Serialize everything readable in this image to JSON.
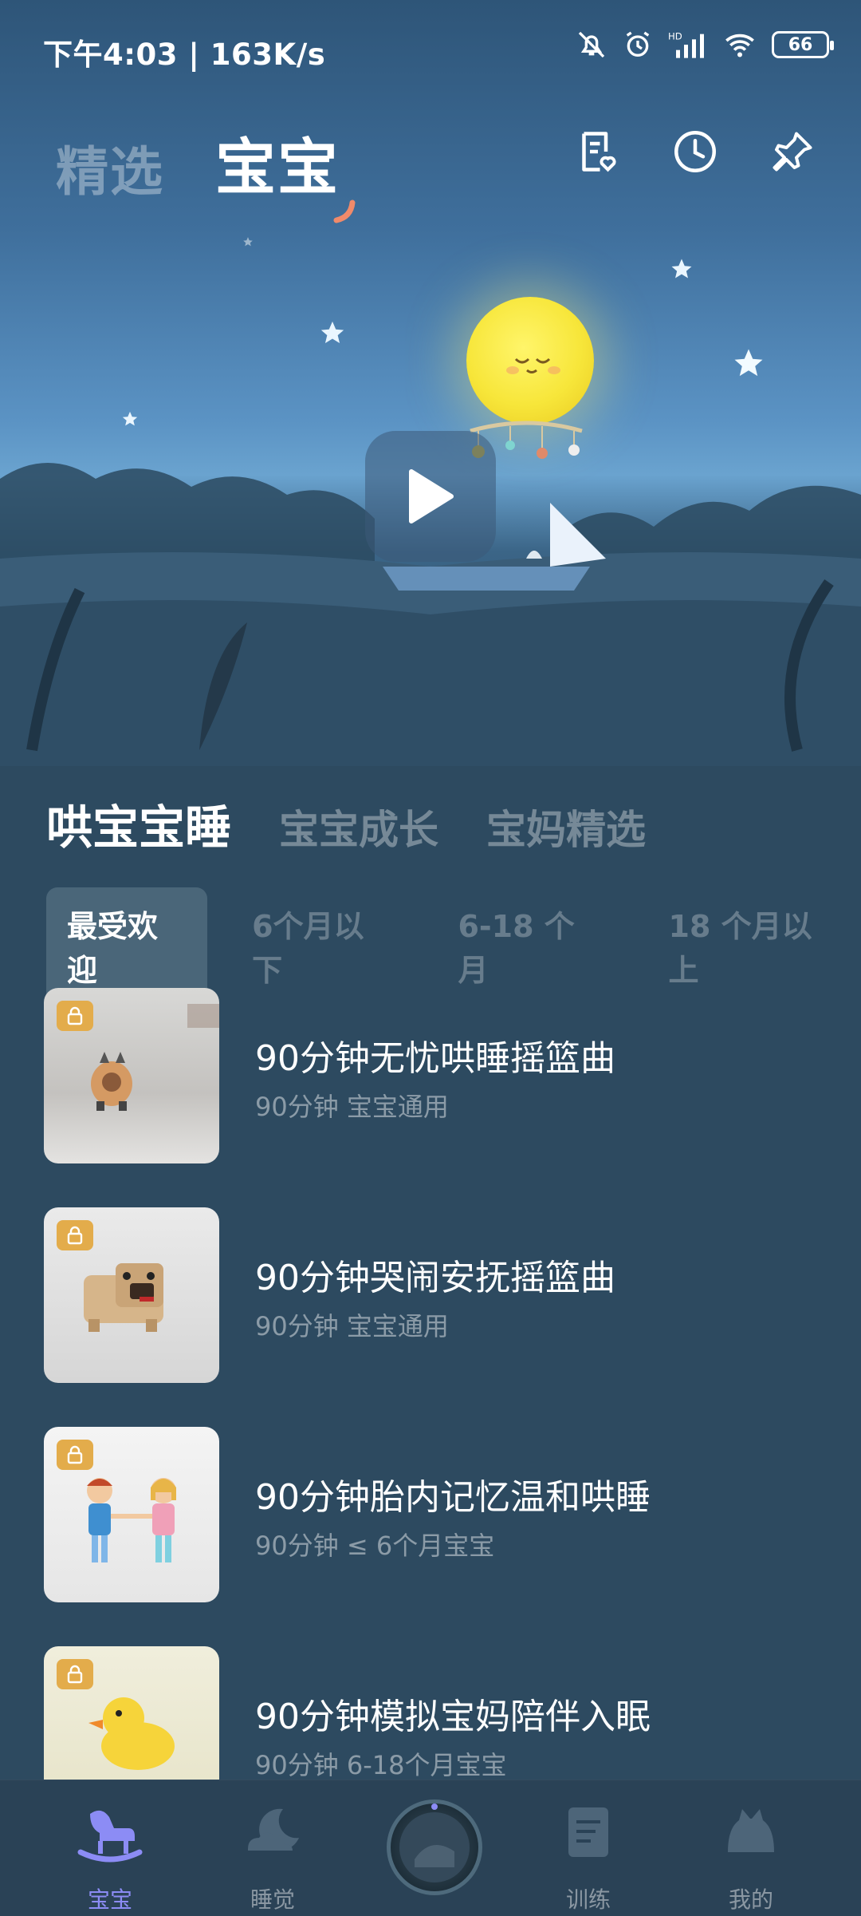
{
  "status_bar": {
    "time": "下午4:03 | 163K/s",
    "battery": "66"
  },
  "top_tabs": [
    {
      "label": "精选",
      "active": false
    },
    {
      "label": "宝宝",
      "active": true
    }
  ],
  "top_actions": [
    "favorites-list-icon",
    "history-clock-icon",
    "pin-icon"
  ],
  "section_tabs": [
    {
      "label": "哄宝宝睡",
      "active": true
    },
    {
      "label": "宝宝成长",
      "active": false
    },
    {
      "label": "宝妈精选",
      "active": false
    }
  ],
  "filter_chips": [
    {
      "label": "最受欢迎",
      "active": true
    },
    {
      "label": "6个月以下",
      "active": false
    },
    {
      "label": "6-18 个月",
      "active": false
    },
    {
      "label": "18 个月以上",
      "active": false
    }
  ],
  "items": [
    {
      "title": "90分钟无忧哄睡摇篮曲",
      "subtitle": "90分钟 宝宝通用"
    },
    {
      "title": "90分钟哭闹安抚摇篮曲",
      "subtitle": "90分钟 宝宝通用"
    },
    {
      "title": "90分钟胎内记忆温和哄睡",
      "subtitle": "90分钟 ≤ 6个月宝宝"
    },
    {
      "title": "90分钟模拟宝妈陪伴入眠",
      "subtitle": "90分钟 6-18个月宝宝"
    }
  ],
  "bottom_nav": [
    {
      "label": "宝宝",
      "active": true
    },
    {
      "label": "睡觉",
      "active": false
    },
    {
      "label": "",
      "active": false
    },
    {
      "label": "训练",
      "active": false
    },
    {
      "label": "我的",
      "active": false
    }
  ],
  "colors": {
    "background": "#2d4a60",
    "accent_nav": "#8c8cf5",
    "lock_badge": "#e3ac4b",
    "moon": "#f7e63a"
  }
}
